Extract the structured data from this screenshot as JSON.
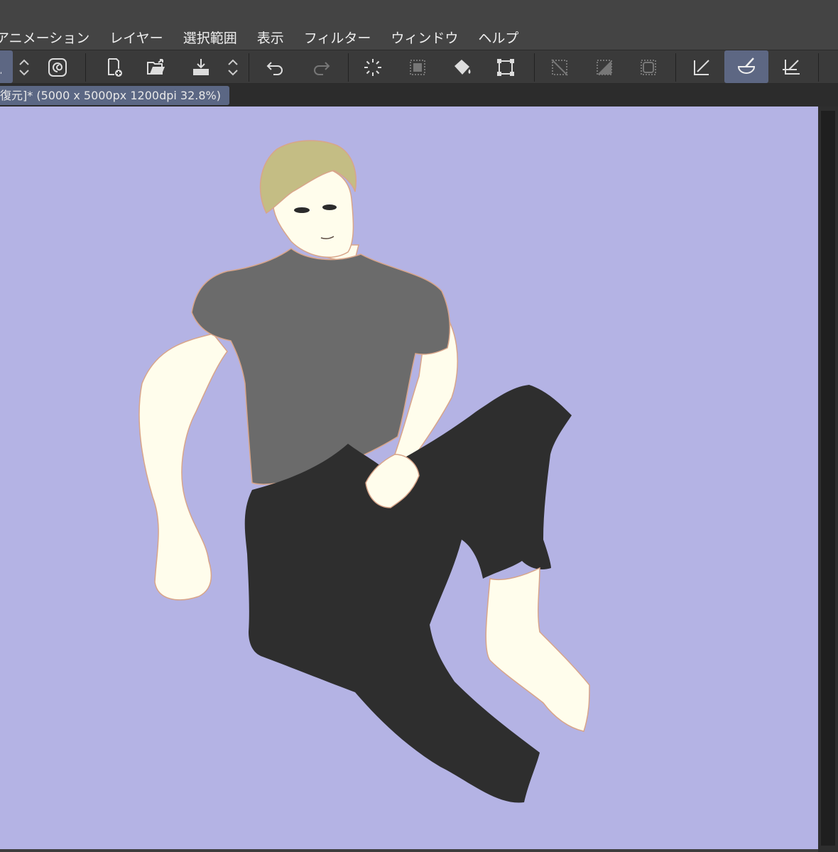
{
  "menu": {
    "items": [
      "アニメーション",
      "レイヤー",
      "選択範囲",
      "表示",
      "フィルター",
      "ウィンドウ",
      "ヘルプ"
    ]
  },
  "toolbar": {
    "icons": [
      "pen-partial-icon",
      "up-down-arrow-icon",
      "swirl-icon",
      "new-file-icon",
      "open-folder-icon",
      "save-icon",
      "up-down-arrow-icon",
      "undo-icon",
      "redo-icon",
      "loading-spinner-icon",
      "select-dotted-icon",
      "fill-bucket-icon",
      "transform-icon",
      "deselect-icon",
      "invert-selection-icon",
      "selection-border-icon",
      "ruler-pen-icon",
      "brush-bowl-icon",
      "snap-ruler-icon"
    ],
    "active_tool": "brush-bowl-icon"
  },
  "document": {
    "tab_title": "復元]* (5000 x 5000px 1200dpi 32.8%)"
  },
  "colors": {
    "canvas_bg": "#b4b3e4",
    "accent": "#5d6783",
    "shirt": "#6b6b6b",
    "pants": "#2e2e2e",
    "skin": "#fffdec",
    "hair": "#c4bd84"
  }
}
